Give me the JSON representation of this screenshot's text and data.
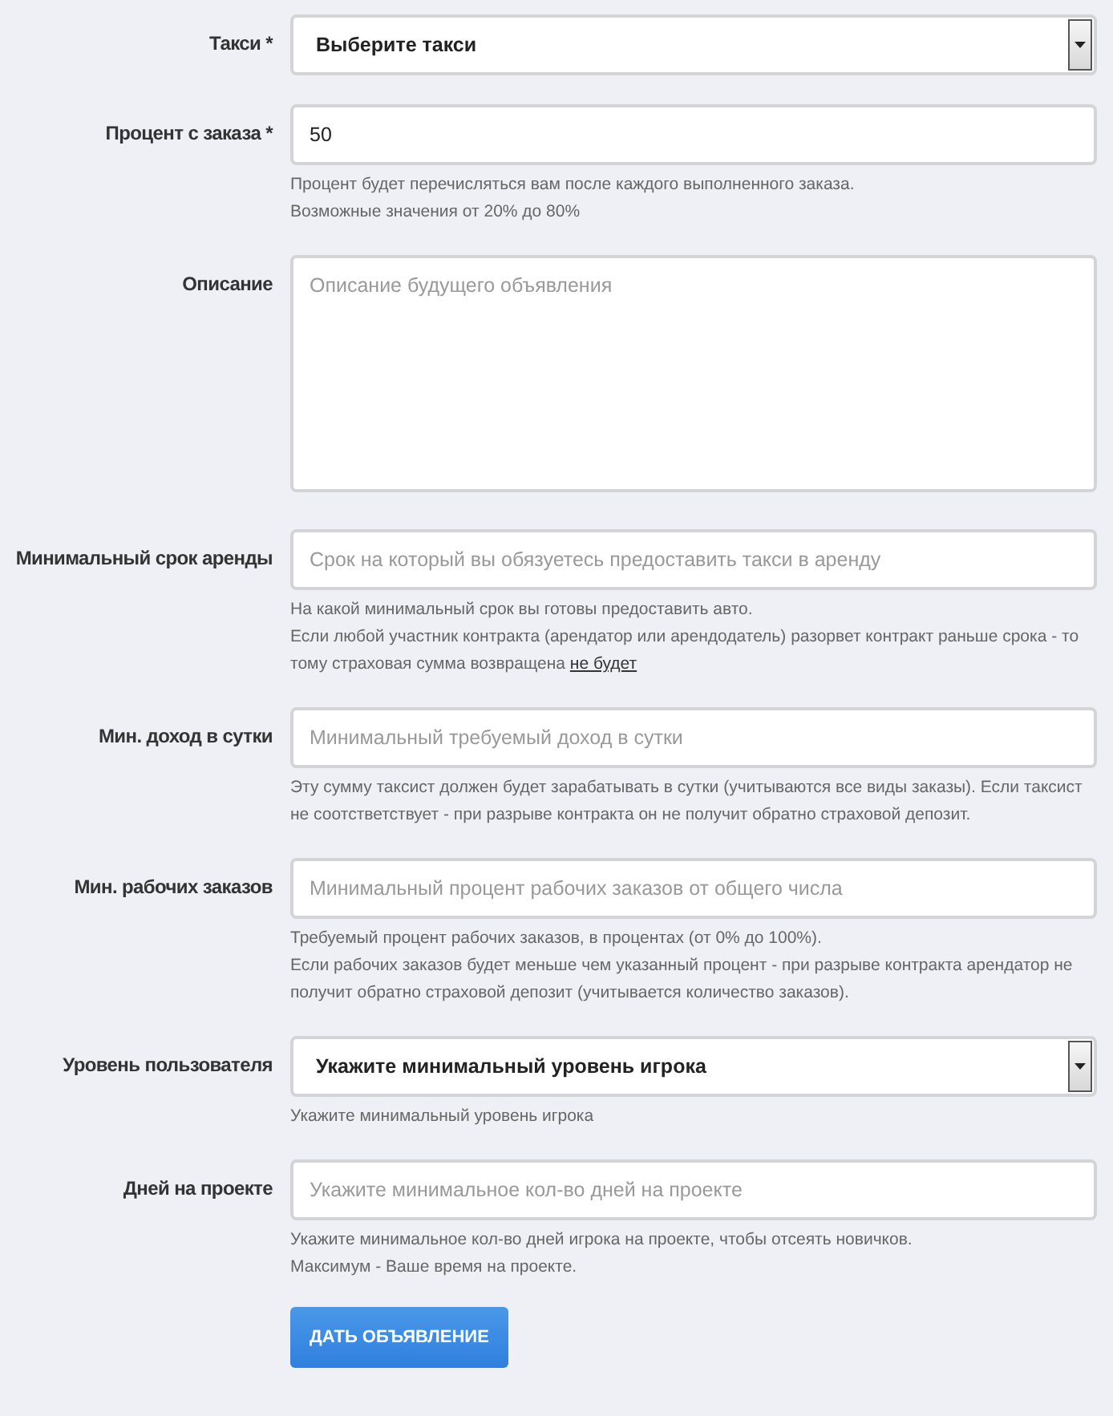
{
  "fields": [
    {
      "label": "Такси *",
      "kind": "select",
      "value": "Выберите такси"
    },
    {
      "label": "Процент с заказа *",
      "kind": "input",
      "value": "50",
      "help": [
        {
          "text": "Процент будет перечисляться вам после каждого выполненного заказа."
        },
        {
          "text": "Возможные значения от 20% до 80%"
        }
      ]
    },
    {
      "label": "Описание",
      "kind": "textarea",
      "placeholder": "Описание будущего объявления"
    },
    {
      "label": "Минимальный срок аренды",
      "kind": "input",
      "placeholder": "Срок на который вы обязуетесь предоставить такси в аренду",
      "help": [
        {
          "text": "На какой минимальный срок вы готовы предоставить авто."
        },
        {
          "text": "Если любой участник контракта (арендатор или арендодатель) разорвет контракт раньше срока - то тому страховая сумма возвращена",
          "link": "не будет"
        }
      ]
    },
    {
      "label": "Мин. доход в сутки",
      "kind": "input",
      "placeholder": "Минимальный требуемый доход в сутки",
      "help": [
        {
          "text": "Эту сумму таксист должен будет зарабатывать в сутки (учитываются все виды заказы). Если таксист не соотстветствует - при разрыве контракта он не получит обратно страховой депозит."
        }
      ]
    },
    {
      "label": "Мин. рабочих заказов",
      "kind": "input",
      "placeholder": "Минимальный процент рабочих заказов от общего числа",
      "help": [
        {
          "text": "Требуемый процент рабочих заказов, в процентах (от 0% до 100%)."
        },
        {
          "text": "Если рабочих заказов будет меньше чем указанный процент - при разрыве контракта арендатор не получит обратно страховой депозит (учитывается количество заказов)."
        }
      ]
    },
    {
      "label": "Уровень пользователя",
      "kind": "select",
      "value": "Укажите минимальный уровень игрока",
      "help": [
        {
          "text": "Укажите минимальный уровень игрока"
        }
      ]
    },
    {
      "label": "Дней на проекте",
      "kind": "input",
      "placeholder": "Укажите минимальное кол-во дней на проекте",
      "help": [
        {
          "text": "Укажите минимальное кол-во дней игрока на проекте, чтобы отсеять новичков."
        },
        {
          "text": "Максимум - Ваше время на проекте."
        }
      ]
    }
  ],
  "submit": "ДАТЬ ОБЪЯВЛЕНИЕ"
}
